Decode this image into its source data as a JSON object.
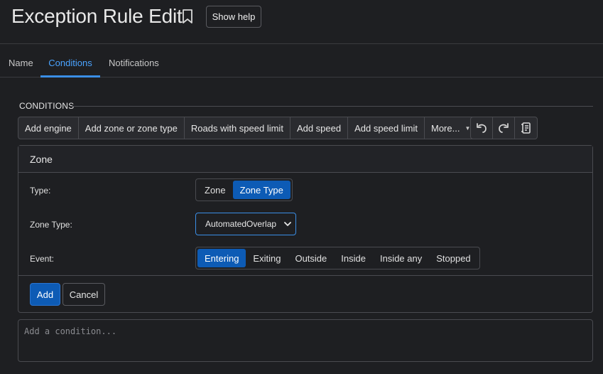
{
  "header": {
    "title": "Exception Rule Edit",
    "help_button": "Show help"
  },
  "tabs": [
    {
      "label": "Name",
      "active": false
    },
    {
      "label": "Conditions",
      "active": true
    },
    {
      "label": "Notifications",
      "active": false
    }
  ],
  "conditions": {
    "section_title": "CONDITIONS",
    "toolbar": {
      "add_engine": "Add engine",
      "add_zone": "Add zone or zone type",
      "roads_speed": "Roads with speed limit",
      "add_speed": "Add speed",
      "add_speed_limit": "Add speed limit",
      "more": "More...",
      "icons": [
        "undo-icon",
        "redo-icon",
        "script-icon"
      ]
    },
    "zone_card": {
      "title": "Zone",
      "type_label": "Type:",
      "type_options": [
        "Zone",
        "Zone Type"
      ],
      "type_selected": "Zone Type",
      "zone_type_label": "Zone Type:",
      "zone_type_value": "AutomatedOverlap",
      "event_label": "Event:",
      "event_options": [
        "Entering",
        "Exiting",
        "Outside",
        "Inside",
        "Inside any",
        "Stopped"
      ],
      "event_selected": "Entering",
      "add_button": "Add",
      "cancel_button": "Cancel"
    },
    "input_placeholder": "Add a condition..."
  },
  "colors": {
    "background": "#1e1f22",
    "accent": "#4aa3ff",
    "primary_button": "#0d5bb5",
    "border": "#4a4b50"
  }
}
